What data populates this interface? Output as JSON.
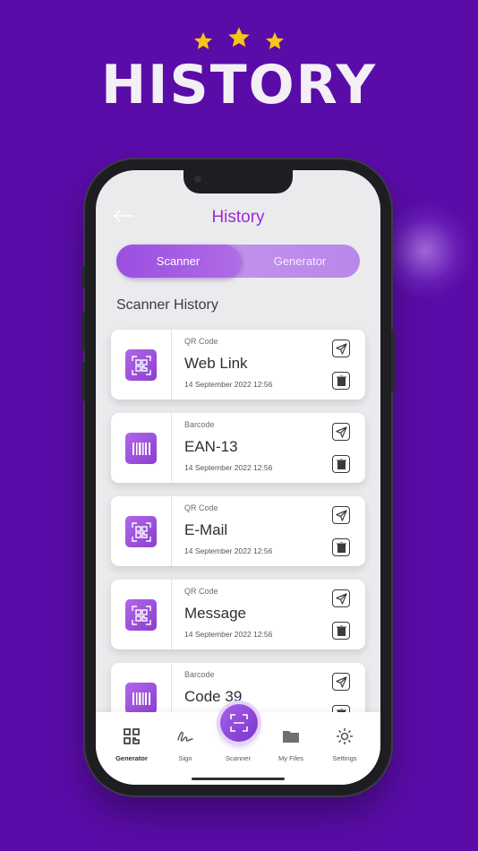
{
  "promo": {
    "headline": "HISTORY",
    "stars": 3,
    "star_color": "#f5c518",
    "background": "#5a0ca8"
  },
  "header": {
    "title": "History"
  },
  "toggle": {
    "options": [
      "Scanner",
      "Generator"
    ],
    "active": "Scanner"
  },
  "section_title": "Scanner History",
  "history": [
    {
      "type": "QR Code",
      "name": "Web Link",
      "date": "14 September 2022 12:56",
      "icon": "qr-code-icon"
    },
    {
      "type": "Barcode",
      "name": "EAN-13",
      "date": "14 September 2022 12:56",
      "icon": "barcode-icon"
    },
    {
      "type": "QR Code",
      "name": "E-Mail",
      "date": "14 September 2022 12:56",
      "icon": "qr-code-icon"
    },
    {
      "type": "QR Code",
      "name": "Message",
      "date": "14 September 2022 12:56",
      "icon": "qr-code-icon"
    },
    {
      "type": "Barcode",
      "name": "Code 39",
      "date": "",
      "icon": "barcode-icon"
    }
  ],
  "tabbar": {
    "items": [
      {
        "label": "Generator",
        "icon": "qr-grid-icon"
      },
      {
        "label": "Sign",
        "icon": "signature-icon"
      },
      {
        "label": "Scanner",
        "icon": "scan-icon"
      },
      {
        "label": "My Files",
        "icon": "folder-icon"
      },
      {
        "label": "Settings",
        "icon": "gear-icon"
      }
    ],
    "active": "Generator"
  },
  "accent": "#9b2bd6"
}
